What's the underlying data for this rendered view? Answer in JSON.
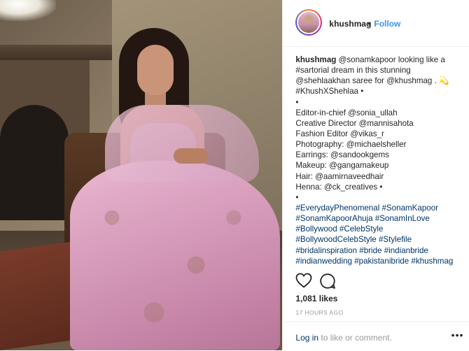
{
  "header": {
    "username": "khushmag",
    "separator": "•",
    "follow_label": "Follow"
  },
  "caption": {
    "author": "khushmag",
    "lines": [
      " @sonamkapoor looking like a",
      "#sartorial dream in this stunning",
      "@shehlaakhan saree for @khushmag . 💫",
      "#KhushXShehlaa •",
      "•",
      "Editor-in-chief @sonia_ullah",
      "Creative Director @mannisahota",
      "Fashion Editor @vikas_r",
      "Photography: @michaelsheller",
      "Earrings: @sandookgems",
      "Makeup: @gangamakeup",
      "Hair: @aamirnaveedhair",
      "Henna: @ck_creatives •",
      "•",
      "#EverydayPhenomenal #SonamKapoor",
      "#SonamKapoorAhuja #SonamInLove",
      "#Bollywood #CelebStyle",
      "#BollywoodCelebStyle #Stylefile",
      "#bridalinspiration #bride #indianbride",
      "#indianwedding #pakistanibride #khushmag"
    ]
  },
  "engagement": {
    "likes": "1,081 likes",
    "time_ago": "17 HOURS AGO"
  },
  "comment_box": {
    "login_link": "Log in",
    "login_rest": " to like or comment.",
    "more": "•••"
  },
  "icons": {
    "like": "heart-icon",
    "comment": "comment-icon",
    "more": "more-options-icon"
  },
  "colors": {
    "link": "#003569",
    "follow": "#3897f0",
    "text": "#262626",
    "muted": "#999999"
  }
}
